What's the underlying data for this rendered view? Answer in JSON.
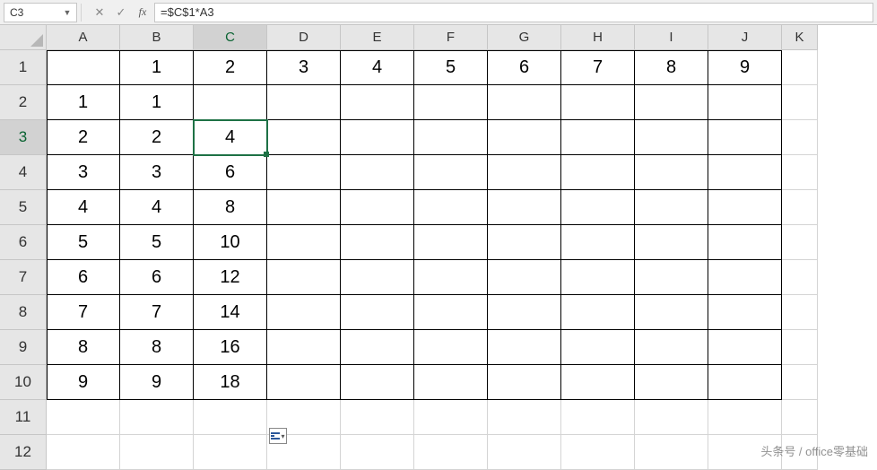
{
  "name_box": "C3",
  "formula": "=$C$1*A3",
  "columns": [
    "A",
    "B",
    "C",
    "D",
    "E",
    "F",
    "G",
    "H",
    "I",
    "J",
    "K"
  ],
  "active_col": "C",
  "active_row": 3,
  "rows": [
    {
      "n": 1,
      "cells": [
        "",
        "1",
        "2",
        "3",
        "4",
        "5",
        "6",
        "7",
        "8",
        "9",
        ""
      ]
    },
    {
      "n": 2,
      "cells": [
        "1",
        "1",
        "",
        "",
        "",
        "",
        "",
        "",
        "",
        "",
        ""
      ]
    },
    {
      "n": 3,
      "cells": [
        "2",
        "2",
        "4",
        "",
        "",
        "",
        "",
        "",
        "",
        "",
        ""
      ]
    },
    {
      "n": 4,
      "cells": [
        "3",
        "3",
        "6",
        "",
        "",
        "",
        "",
        "",
        "",
        "",
        ""
      ]
    },
    {
      "n": 5,
      "cells": [
        "4",
        "4",
        "8",
        "",
        "",
        "",
        "",
        "",
        "",
        "",
        ""
      ]
    },
    {
      "n": 6,
      "cells": [
        "5",
        "5",
        "10",
        "",
        "",
        "",
        "",
        "",
        "",
        "",
        ""
      ]
    },
    {
      "n": 7,
      "cells": [
        "6",
        "6",
        "12",
        "",
        "",
        "",
        "",
        "",
        "",
        "",
        ""
      ]
    },
    {
      "n": 8,
      "cells": [
        "7",
        "7",
        "14",
        "",
        "",
        "",
        "",
        "",
        "",
        "",
        ""
      ]
    },
    {
      "n": 9,
      "cells": [
        "8",
        "8",
        "16",
        "",
        "",
        "",
        "",
        "",
        "",
        "",
        ""
      ]
    },
    {
      "n": 10,
      "cells": [
        "9",
        "9",
        "18",
        "",
        "",
        "",
        "",
        "",
        "",
        "",
        ""
      ]
    },
    {
      "n": 11,
      "cells": [
        "",
        "",
        "",
        "",
        "",
        "",
        "",
        "",
        "",
        "",
        ""
      ]
    },
    {
      "n": 12,
      "cells": [
        "",
        "",
        "",
        "",
        "",
        "",
        "",
        "",
        "",
        "",
        ""
      ]
    }
  ],
  "watermark": "头条号 / office零基础"
}
